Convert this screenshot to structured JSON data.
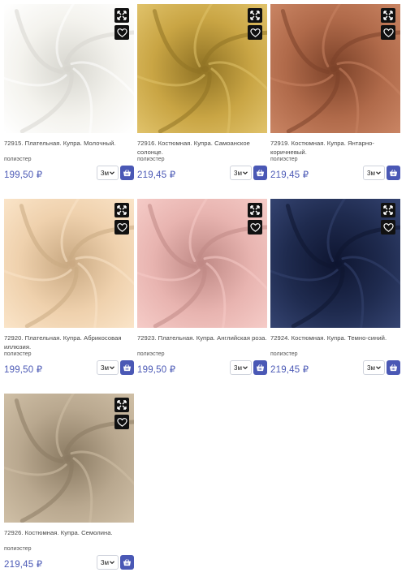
{
  "products": [
    {
      "title": "72915. Плательная. Купра. Молочный.",
      "material": "полиэстер",
      "price": "199,50 ₽",
      "qty": "3м",
      "colors": {
        "base": "#f4f3ee",
        "shadow": "#d7d6cf",
        "highlight": "#ffffff"
      }
    },
    {
      "title": "72916. Костюмная. Купра. Самоанское солонце.",
      "material": "полиэстер",
      "price": "219,45 ₽",
      "qty": "3м",
      "colors": {
        "base": "#c9a544",
        "shadow": "#8f7224",
        "highlight": "#e0c26a"
      }
    },
    {
      "title": "72919. Костюмная. Купра. Янтарно-коричневый.",
      "material": "полиэстер",
      "price": "219,45 ₽",
      "qty": "3м",
      "colors": {
        "base": "#b06a4a",
        "shadow": "#7c4229",
        "highlight": "#c98463"
      }
    },
    {
      "title": "72920. Плательная. Купра. Абрикосовая иллюзия.",
      "material": "полиэстер",
      "price": "199,50 ₽",
      "qty": "3м",
      "colors": {
        "base": "#efd1ad",
        "shadow": "#c9a982",
        "highlight": "#fae4c8"
      }
    },
    {
      "title": "72923. Плательная. Купра. Английская роза.",
      "material": "полиэстер",
      "price": "199,50 ₽",
      "qty": "3м",
      "colors": {
        "base": "#e8b4b0",
        "shadow": "#bf8985",
        "highlight": "#f5cbc7"
      }
    },
    {
      "title": "72924. Костюмная. Купра. Темно-синий.",
      "material": "полиэстер",
      "price": "219,45 ₽",
      "qty": "3м",
      "colors": {
        "base": "#1f2b4f",
        "shadow": "#0e1530",
        "highlight": "#344370"
      }
    },
    {
      "title": "72926. Костюмная. Купра. Семолина.",
      "material": "полиэстер",
      "price": "219,45 ₽",
      "qty": "3м",
      "colors": {
        "base": "#b9a88f",
        "shadow": "#8a7a62",
        "highlight": "#cfbfa6"
      }
    }
  ],
  "icons": {
    "expand": "expand-icon",
    "favorite": "heart-icon",
    "cart": "cart-icon",
    "dropdown": "chevron-down-icon"
  },
  "accent": "#4a58b5"
}
